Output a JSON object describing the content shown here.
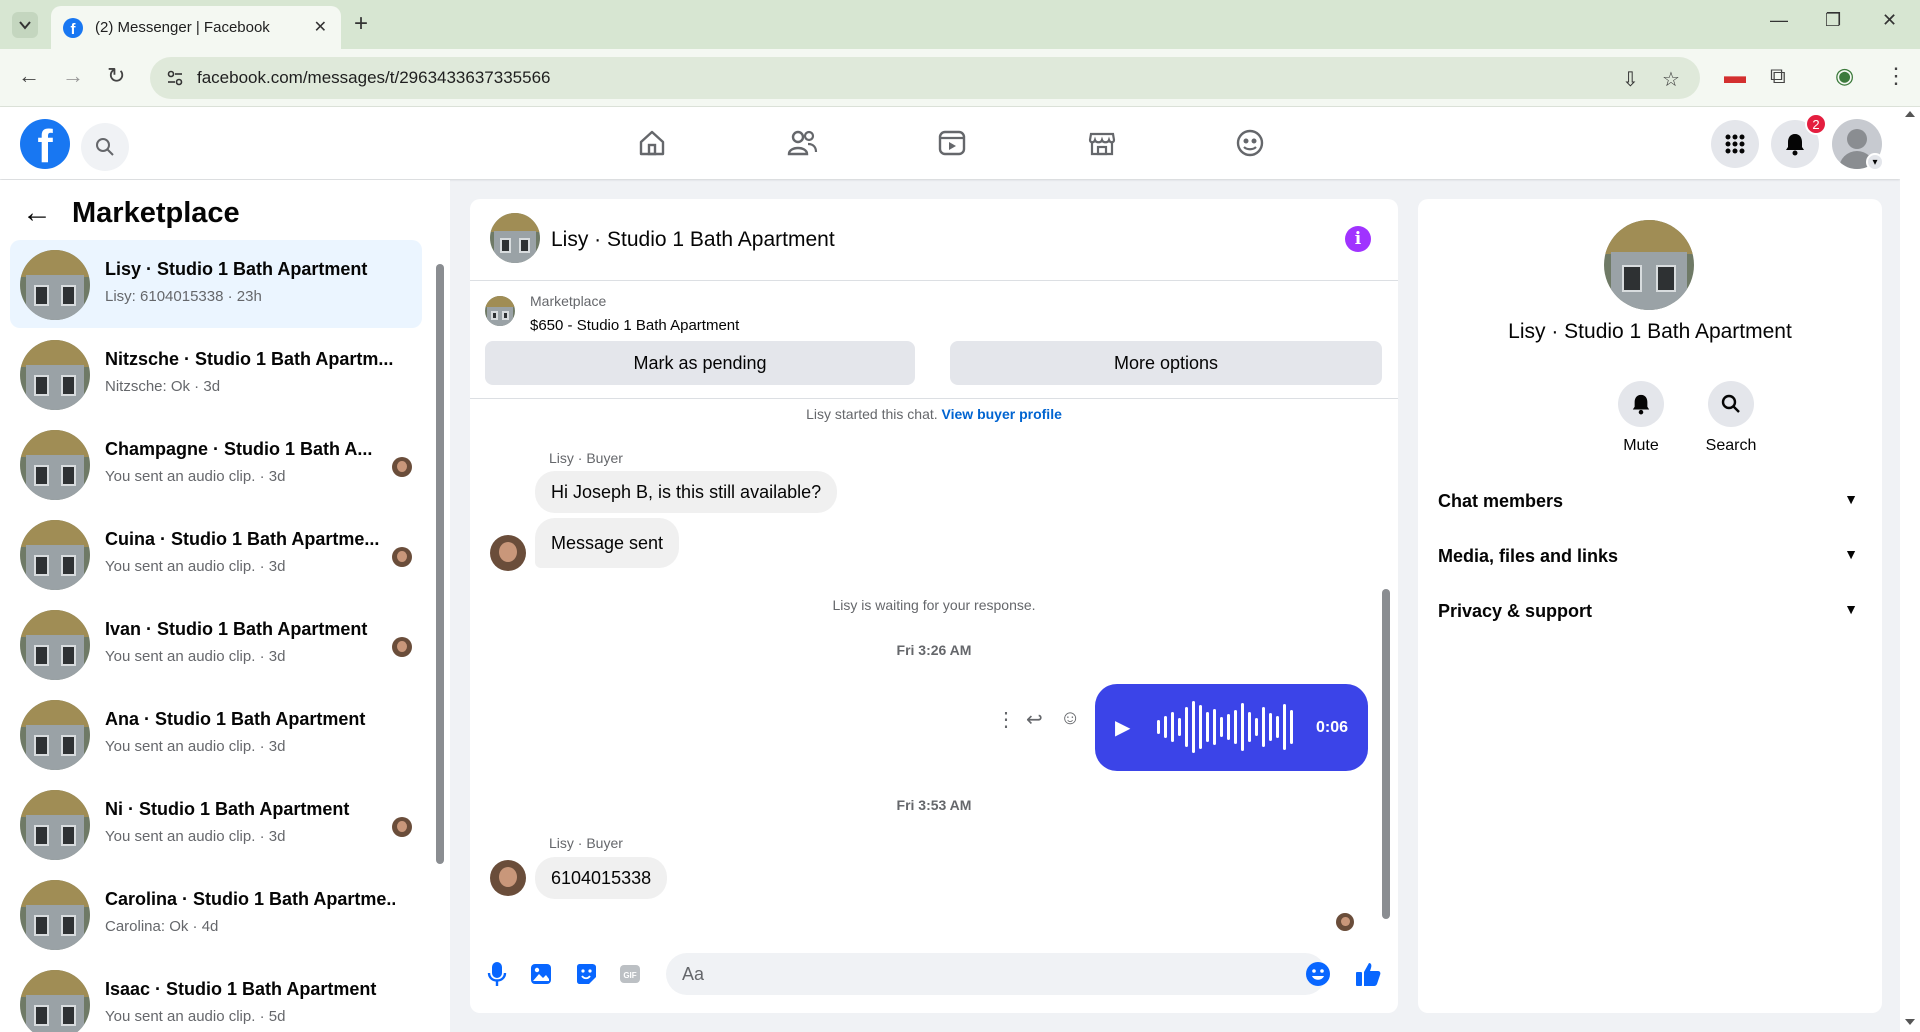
{
  "browser": {
    "tab_title": "(2) Messenger | Facebook",
    "url": "facebook.com/messages/t/2963433637335566"
  },
  "header": {
    "notification_count": "2"
  },
  "sidebar": {
    "title": "Marketplace",
    "conversations": [
      {
        "name": "Lisy · Studio 1 Bath Apartment",
        "preview": "Lisy: 6104015338 · 23h",
        "active": true
      },
      {
        "name": "Nitzsche · Studio 1 Bath Apartm...",
        "preview": "Nitzsche: Ok · 3d"
      },
      {
        "name": "Champagne · Studio 1 Bath A...",
        "preview": "You sent an audio clip. · 3d"
      },
      {
        "name": "Cuina · Studio 1 Bath Apartme...",
        "preview": "You sent an audio clip. · 3d"
      },
      {
        "name": "Ivan · Studio 1 Bath Apartment",
        "preview": "You sent an audio clip. · 3d"
      },
      {
        "name": "Ana · Studio 1 Bath Apartment",
        "preview": "You sent an audio clip. · 3d"
      },
      {
        "name": "Ni · Studio 1 Bath Apartment",
        "preview": "You sent an audio clip. · 3d"
      },
      {
        "name": "Carolina · Studio 1 Bath Apartme...",
        "preview": "Carolina: Ok · 4d"
      },
      {
        "name": "Isaac · Studio 1 Bath Apartment",
        "preview": "You sent an audio clip. · 5d"
      }
    ]
  },
  "chat": {
    "title": "Lisy · Studio 1 Bath Apartment",
    "marketplace_label": "Marketplace",
    "listing": "$650 - Studio 1 Bath Apartment",
    "mark_pending_label": "Mark as pending",
    "more_options_label": "More options",
    "started_text": "Lisy started this chat.",
    "view_buyer_label": "View buyer profile",
    "sender_label": "Lisy · Buyer",
    "msg1": "Hi Joseph B, is this still available?",
    "msg2": "Message sent",
    "waiting_text": "Lisy is waiting for your response.",
    "time1": "Fri 3:26 AM",
    "audio_duration": "0:06",
    "time2": "Fri 3:53 AM",
    "sender_label_2": "Lisy · Buyer",
    "msg3": "6104015338",
    "input_placeholder": "Aa"
  },
  "info_panel": {
    "name": "Lisy · Studio 1 Bath Apartment",
    "mute_label": "Mute",
    "search_label": "Search",
    "sections": [
      "Chat members",
      "Media, files and links",
      "Privacy & support"
    ]
  },
  "colors": {
    "accent": "#1877f2",
    "audio_bubble": "#3b44e8",
    "info_icon": "#a033ff"
  }
}
